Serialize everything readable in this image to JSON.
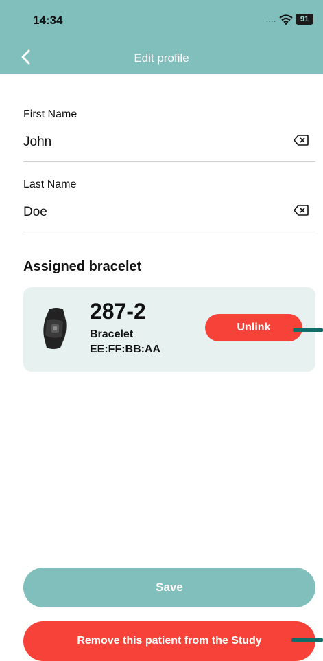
{
  "status_bar": {
    "time": "14:34",
    "signal": "....",
    "battery": "91"
  },
  "header": {
    "title": "Edit profile",
    "back_icon": "chevron-left-icon"
  },
  "form": {
    "first_name": {
      "label": "First Name",
      "value": "John",
      "clear_icon": "backspace-clear-icon"
    },
    "last_name": {
      "label": "Last Name",
      "value": "Doe",
      "clear_icon": "backspace-clear-icon"
    }
  },
  "bracelet_section": {
    "title": "Assigned bracelet",
    "bracelet": {
      "id": "287-2",
      "type": "Bracelet",
      "mac": "EE:FF:BB:AA",
      "image": "bracelet-icon"
    },
    "unlink_label": "Unlink"
  },
  "actions": {
    "save_label": "Save",
    "remove_label": "Remove this patient from the Study"
  },
  "colors": {
    "header_bg": "#80bfbc",
    "danger": "#f7423a",
    "card_bg": "#e6f1f0",
    "pointer": "#0f6e6a"
  }
}
